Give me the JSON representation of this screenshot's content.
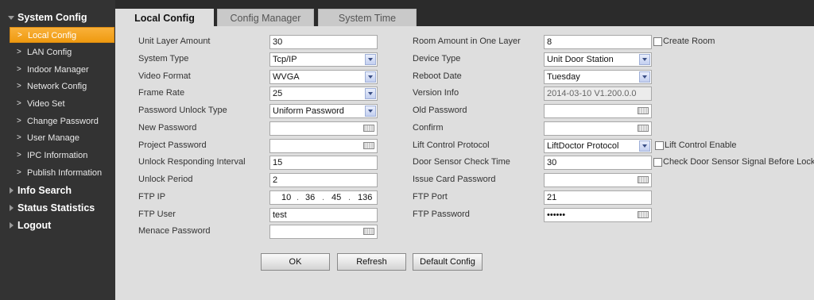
{
  "sidebar": {
    "sections": [
      {
        "label": "System Config",
        "icon": "caret-down-icon",
        "expanded": true
      },
      {
        "label": "Info Search",
        "icon": "caret-right-icon",
        "expanded": false
      },
      {
        "label": "Status Statistics",
        "icon": "caret-right-icon",
        "expanded": false
      },
      {
        "label": "Logout",
        "icon": "caret-right-icon",
        "expanded": false
      }
    ],
    "items": [
      {
        "label": "Local Config",
        "active": true
      },
      {
        "label": "LAN Config"
      },
      {
        "label": "Indoor Manager"
      },
      {
        "label": "Network Config"
      },
      {
        "label": "Video Set"
      },
      {
        "label": "Change Password"
      },
      {
        "label": "User Manage"
      },
      {
        "label": "IPC Information"
      },
      {
        "label": "Publish Information"
      }
    ],
    "chevron": ">"
  },
  "tabs": [
    {
      "label": "Local Config",
      "active": true
    },
    {
      "label": "Config Manager"
    },
    {
      "label": "System Time"
    }
  ],
  "form": {
    "left": {
      "unit_layer_amount": {
        "label": "Unit Layer Amount",
        "value": "30"
      },
      "system_type": {
        "label": "System Type",
        "value": "Tcp/IP"
      },
      "video_format": {
        "label": "Video Format",
        "value": "WVGA"
      },
      "frame_rate": {
        "label": "Frame Rate",
        "value": "25"
      },
      "password_unlock_type": {
        "label": "Password Unlock Type",
        "value": "Uniform Password"
      },
      "new_password": {
        "label": "New Password",
        "value": ""
      },
      "project_password": {
        "label": "Project Password",
        "value": ""
      },
      "unlock_responding_interval": {
        "label": "Unlock Responding Interval",
        "value": "15"
      },
      "unlock_period": {
        "label": "Unlock Period",
        "value": "2"
      },
      "ftp_ip": {
        "label": "FTP IP",
        "octets": [
          "10",
          "36",
          "45",
          "136"
        ],
        "separator": "."
      },
      "ftp_user": {
        "label": "FTP User",
        "value": "test"
      },
      "menace_password": {
        "label": "Menace Password",
        "value": ""
      }
    },
    "right": {
      "room_amount": {
        "label": "Room Amount in One Layer",
        "value": "8",
        "checkbox_label": "Create Room",
        "checked": false
      },
      "device_type": {
        "label": "Device Type",
        "value": "Unit Door Station"
      },
      "reboot_date": {
        "label": "Reboot Date",
        "value": "Tuesday"
      },
      "version_info": {
        "label": "Version Info",
        "value": "2014-03-10 V1.200.0.0"
      },
      "old_password": {
        "label": "Old Password",
        "value": ""
      },
      "confirm": {
        "label": "Confirm",
        "value": ""
      },
      "lift_control_protocol": {
        "label": "Lift Control Protocol",
        "value": "LiftDoctor Protocol",
        "checkbox_label": "Lift Control Enable",
        "checked": false
      },
      "door_sensor_check_time": {
        "label": "Door Sensor Check Time",
        "value": "30",
        "checkbox_label": "Check Door Sensor Signal Before Lock",
        "checked": false
      },
      "issue_card_password": {
        "label": "Issue Card Password",
        "value": ""
      },
      "ftp_port": {
        "label": "FTP Port",
        "value": "21"
      },
      "ftp_password": {
        "label": "FTP Password",
        "value": "••••••"
      }
    }
  },
  "buttons": {
    "ok": "OK",
    "refresh": "Refresh",
    "default_config": "Default Config"
  },
  "colors": {
    "sidebar_bg": "#333333",
    "active_item": "#f6a623",
    "panel_bg": "#dedede"
  }
}
